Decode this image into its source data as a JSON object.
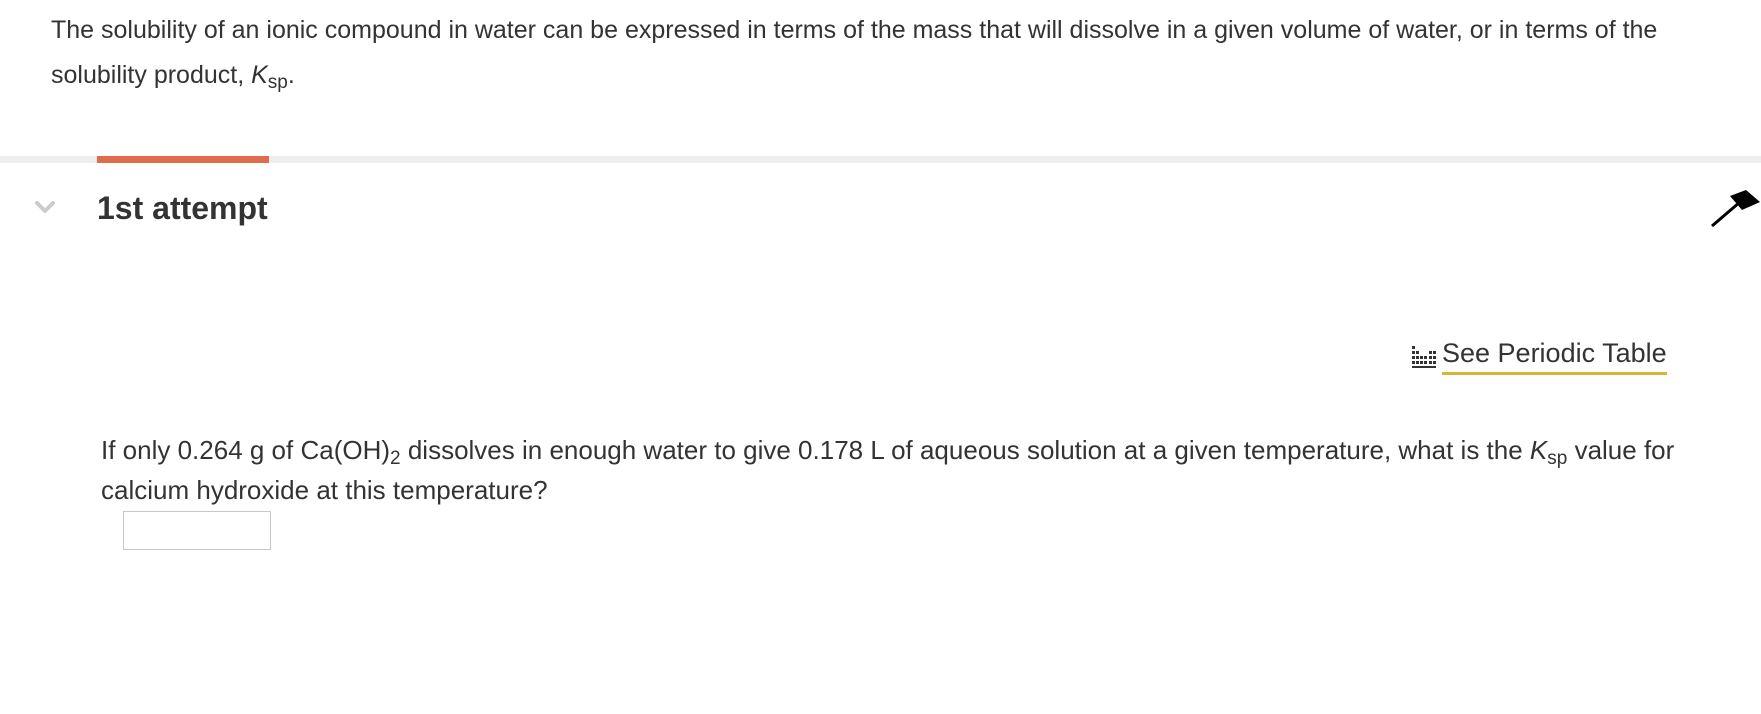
{
  "intro": {
    "text_before": "The solubility of an ionic compound in water can be expressed in terms of the mass that will dissolve in a given volume of water, or in terms of the solubility product, ",
    "k_symbol": "K",
    "k_subscript": "sp",
    "text_after": "."
  },
  "attempt": {
    "title": "1st attempt"
  },
  "periodic_table": {
    "label": "See Periodic Table",
    "icon": "periodic-table-icon"
  },
  "question": {
    "part1": "If only 0.264 g of Ca(OH)",
    "subscript_2": "2",
    "part2": " dissolves in enough water to give 0.178 L of aqueous solution at a given temperature, what is the ",
    "k_symbol": "K",
    "k_subscript": "sp",
    "part3": " value for calcium hydroxide at this temperature?"
  },
  "answer": {
    "value": "",
    "placeholder": ""
  },
  "colors": {
    "accent": "#e06c4d",
    "link_underline": "#d8b43a",
    "divider": "#eeeeee",
    "text": "#333333"
  },
  "icons": {
    "chevron": "chevron-down-icon",
    "collapse": "arrow-up-icon"
  }
}
